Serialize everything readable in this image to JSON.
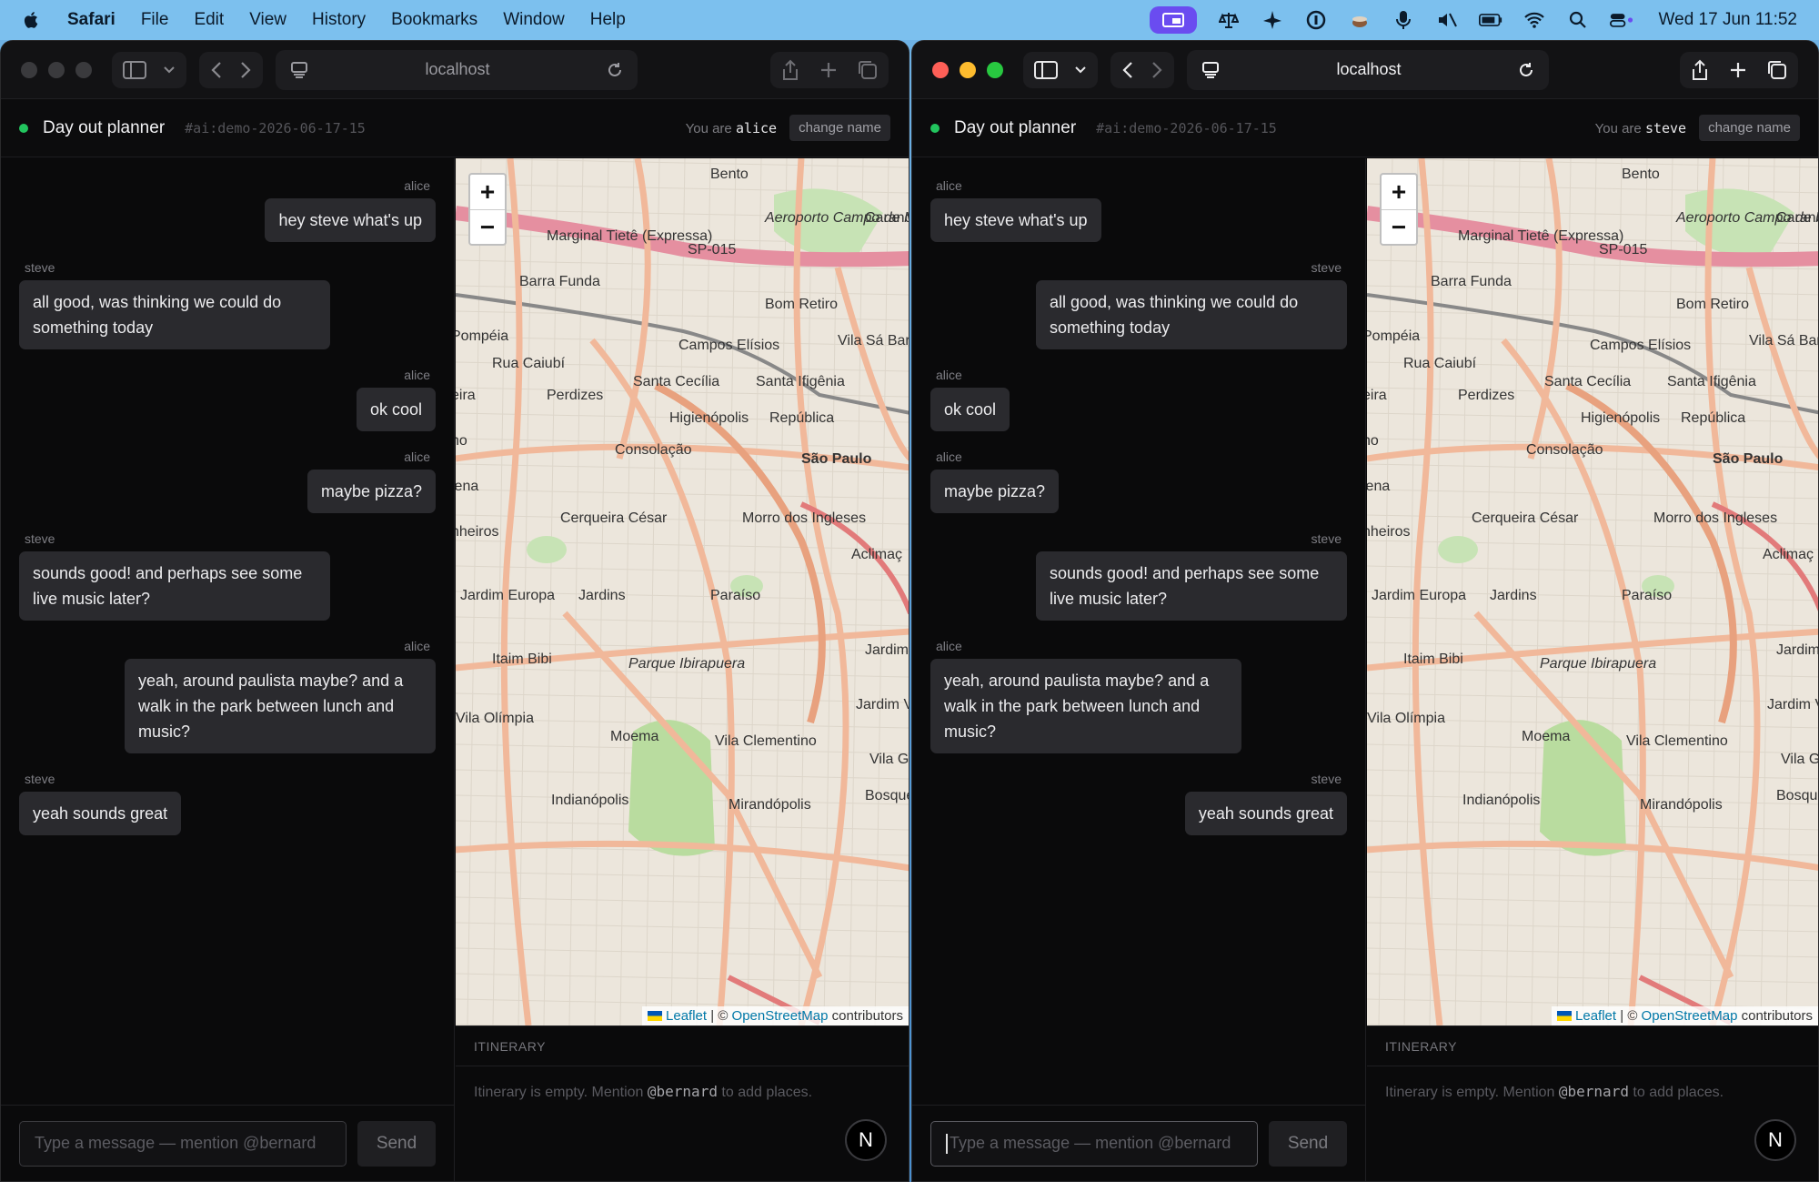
{
  "menubar": {
    "app": "Safari",
    "items": [
      "File",
      "Edit",
      "View",
      "History",
      "Bookmarks",
      "Window",
      "Help"
    ],
    "clock": "Wed 17 Jun  11:52"
  },
  "windows": [
    {
      "url": "localhost",
      "header": {
        "title": "Day out planner",
        "channel": "#ai:demo-2026-06-17-15",
        "you_prefix": "You are",
        "user": "alice",
        "change_name": "change name"
      },
      "composer": {
        "placeholder": "Type a message — mention @bernard",
        "send": "Send"
      },
      "itinerary": {
        "heading": "ITINERARY",
        "empty_prefix": "Itinerary is empty. Mention",
        "mention": "@bernard",
        "empty_suffix": "to add places."
      },
      "badge": "N"
    },
    {
      "url": "localhost",
      "header": {
        "title": "Day out planner",
        "channel": "#ai:demo-2026-06-17-15",
        "you_prefix": "You are",
        "user": "steve",
        "change_name": "change name"
      },
      "composer": {
        "placeholder": "Type a message — mention @bernard",
        "send": "Send"
      },
      "itinerary": {
        "heading": "ITINERARY",
        "empty_prefix": "Itinerary is empty. Mention",
        "mention": "@bernard",
        "empty_suffix": "to add places."
      },
      "badge": "N"
    }
  ],
  "messages": [
    {
      "author": "alice",
      "text": "hey steve what's up"
    },
    {
      "author": "steve",
      "text": "all good, was thinking we could do something today"
    },
    {
      "author": "alice",
      "text": "ok cool"
    },
    {
      "author": "alice",
      "text": "maybe pizza?"
    },
    {
      "author": "steve",
      "text": "sounds good! and perhaps see some live music later?"
    },
    {
      "author": "alice",
      "text": "yeah, around paulista maybe? and a walk in the park between lunch and music?"
    },
    {
      "author": "steve",
      "text": "yeah sounds great"
    }
  ],
  "map": {
    "zoom_in": "+",
    "zoom_out": "−",
    "attribution": {
      "leaflet": "Leaflet",
      "sep": "| ©",
      "osm": "OpenStreetMap",
      "suffix": "contributors"
    },
    "labels": [
      "Bento",
      "Aeroporto Campo de Marte",
      "Carand",
      "Marginal Tietê (Expressa)",
      "SP-015",
      "Barra Funda",
      "Bom Retiro",
      "Pompéia",
      "Campos Elísios",
      "Vila Sá Barb",
      "Rua Caiubí",
      "Santa Cecília",
      "Santa Ifigênia",
      "Perdizes",
      "Higienópolis",
      "República",
      "Consolação",
      "São Paulo",
      "Cerqueira César",
      "Morro dos Ingleses",
      "Aclimaç",
      "Jardim Europa",
      "Jardins",
      "Paraíso",
      "Itaim Bibi",
      "Parque Ibirapuera",
      "Jardim",
      "Vila Olímpia",
      "Moema",
      "Vila Clementino",
      "Jardim V Marian",
      "Vila G",
      "Indianópolis",
      "Mirandópolis",
      "Bosque Saúd",
      "eira",
      "ho",
      "lena",
      "nheiros"
    ]
  },
  "colors": {
    "online": "#22c55e",
    "bubble": "#2a2a2e",
    "accent_pill": "#6a4cf0"
  }
}
